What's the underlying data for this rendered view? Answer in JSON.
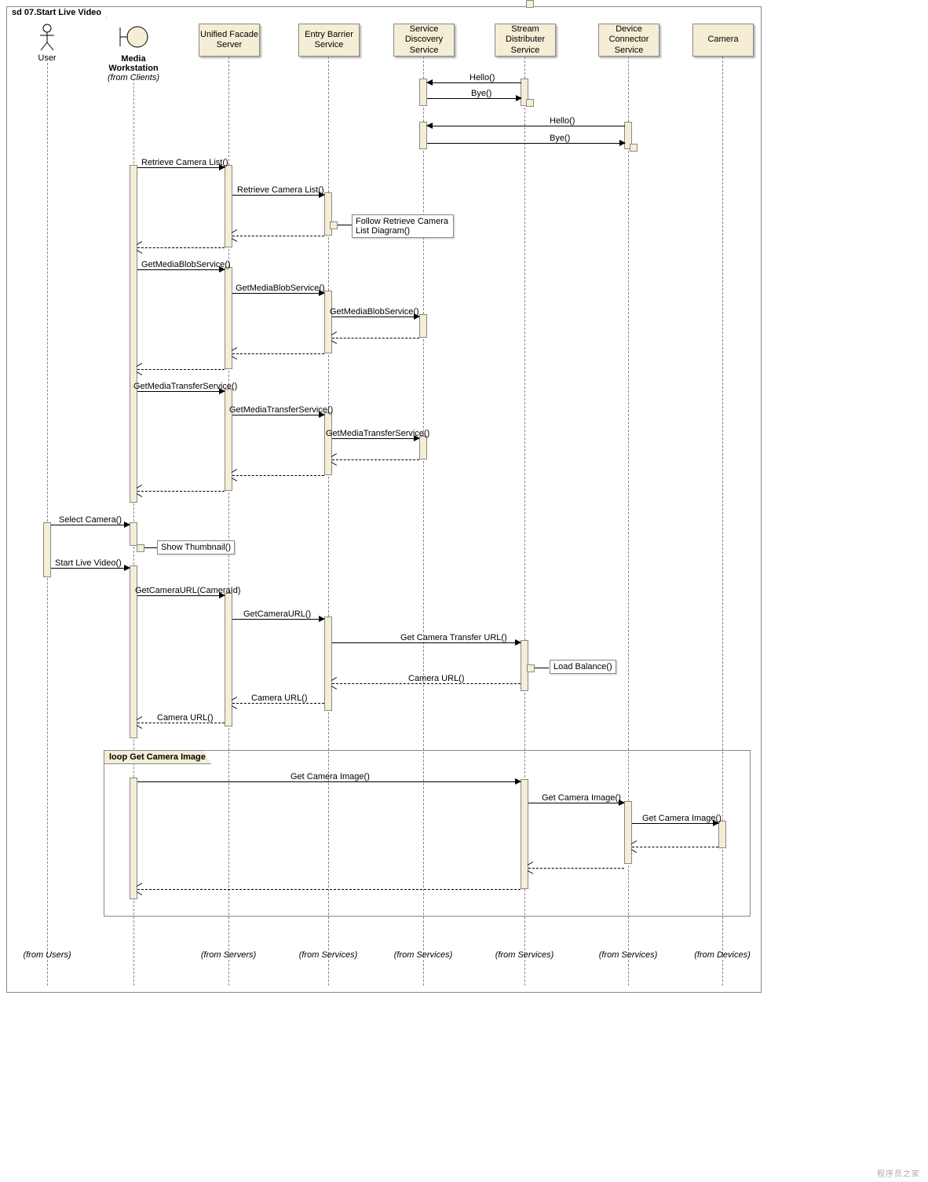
{
  "title": "sd 07.Start Live Video",
  "participants": {
    "user": {
      "name": "User",
      "footer": "(from Users)"
    },
    "media": {
      "name": "Media Workstation",
      "sub": "(from Clients)"
    },
    "ufs": {
      "name": "Unified Facade Server",
      "footer": "(from Servers)"
    },
    "ebs": {
      "name": "Entry Barrier Service",
      "footer": "(from Services)"
    },
    "sds": {
      "name": "Service Discovery Service",
      "footer": "(from Services)"
    },
    "sdist": {
      "name": "Stream Distributer Service",
      "footer": "(from Services)"
    },
    "dcs": {
      "name": "Device Connector Service",
      "footer": "(from Services)"
    },
    "camera": {
      "name": "Camera",
      "footer": "(from Devices)"
    }
  },
  "messages": {
    "hello1": "Hello()",
    "bye1": "Bye()",
    "hello2": "Hello()",
    "bye2": "Bye()",
    "rcl1": "Retrieve Camera List()",
    "rcl2": "Retrieve Camera List()",
    "followRCL": "Follow Retrieve Camera List Diagram()",
    "gmbs1": "GetMediaBlobService()",
    "gmbs2": "GetMediaBlobService()",
    "gmbs3": "GetMediaBlobService()",
    "gmts1": "GetMediaTransferService()",
    "gmts2": "GetMediaTransferService()",
    "gmts3": "GetMediaTransferService()",
    "selectCamera": "Select Camera()",
    "showThumb": "Show Thumbnail()",
    "startLive": "Start Live Video()",
    "getCamUrl1": "GetCameraURL(CameraId)",
    "getCamUrl2": "GetCameraURL()",
    "getCamTransUrl": "Get Camera Transfer URL()",
    "loadBalance": "Load Balance()",
    "camUrl": "Camera URL()",
    "getCamImg": "Get Camera Image()"
  },
  "loop": {
    "label": "loop Get Camera Image"
  },
  "watermark": "程序员之家"
}
